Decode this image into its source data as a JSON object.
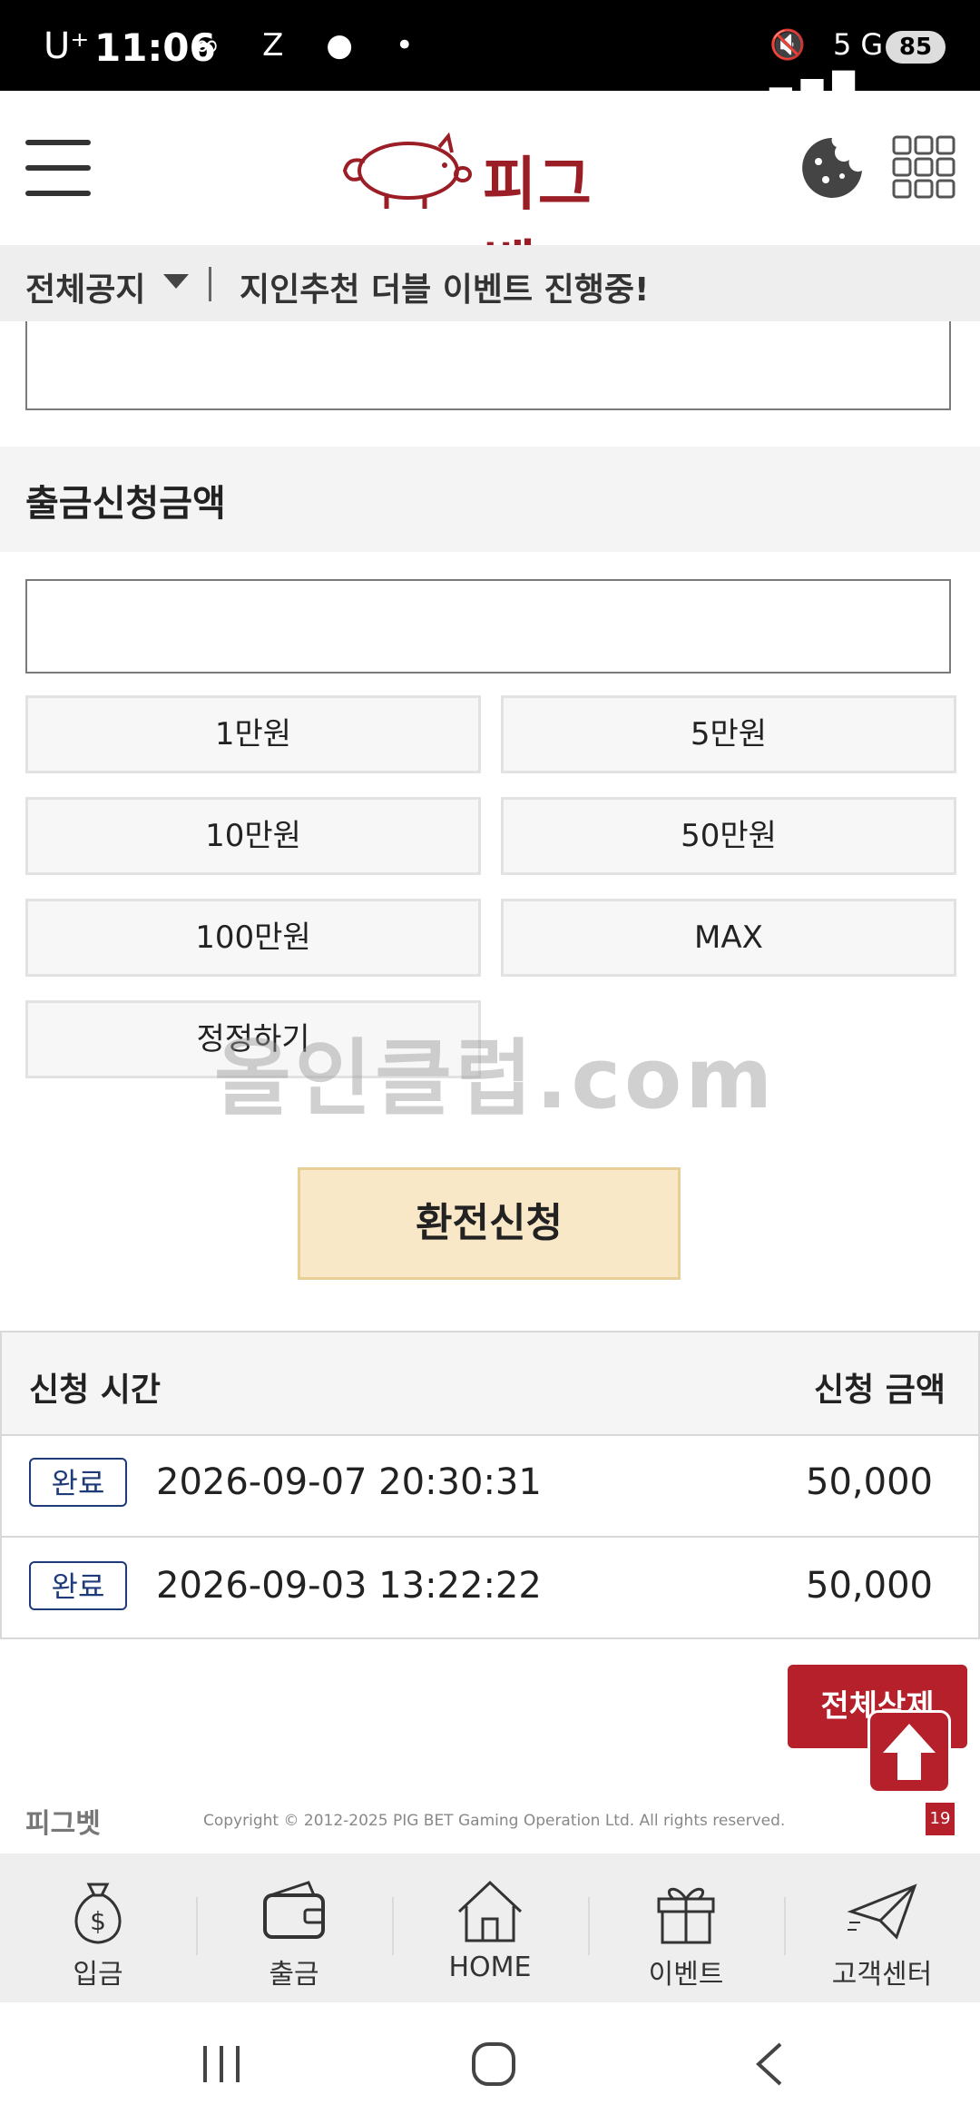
{
  "status_bar": {
    "carrier": "U⁺",
    "time": "11:06",
    "battery": "85",
    "left_icons": "∞ Z ● •",
    "right_icons": "🔇 5G ▂▄▆"
  },
  "header": {
    "logo_text": "피그벳"
  },
  "notice": {
    "label": "전체공지",
    "message": "지인추천 더블 이벤트 진행중!"
  },
  "withdraw": {
    "title": "출금신청금액",
    "amount_value": "",
    "quick_amounts": [
      "1만원",
      "5만원",
      "10만원",
      "50만원",
      "100만원",
      "MAX"
    ],
    "reset_label": "정정하기",
    "submit_label": "환전신청"
  },
  "watermark": "올인클럽.com",
  "history": {
    "col_time": "신청 시간",
    "col_amount": "신청 금액",
    "rows": [
      {
        "status": "완료",
        "time": "2026-09-07 20:30:31",
        "amount": "50,000"
      },
      {
        "status": "완료",
        "time": "2026-09-03 13:22:22",
        "amount": "50,000"
      }
    ],
    "delete_all_label": "전체삭제"
  },
  "footer": {
    "logo_text": "피그벳",
    "copyright": "Copyright © 2012-2025 PIG BET Gaming Operation Ltd. All rights reserved.",
    "age_badge": "19"
  },
  "bottom_nav": [
    {
      "label": "입금",
      "icon": "money-bag-icon"
    },
    {
      "label": "출금",
      "icon": "wallet-icon"
    },
    {
      "label": "HOME",
      "icon": "house-icon"
    },
    {
      "label": "이벤트",
      "icon": "gift-icon"
    },
    {
      "label": "고객센터",
      "icon": "paper-plane-icon"
    }
  ],
  "colors": {
    "brand_red": "#b5202a",
    "submit_bg": "#f8e8c8",
    "badge_blue": "#1f3a78"
  }
}
